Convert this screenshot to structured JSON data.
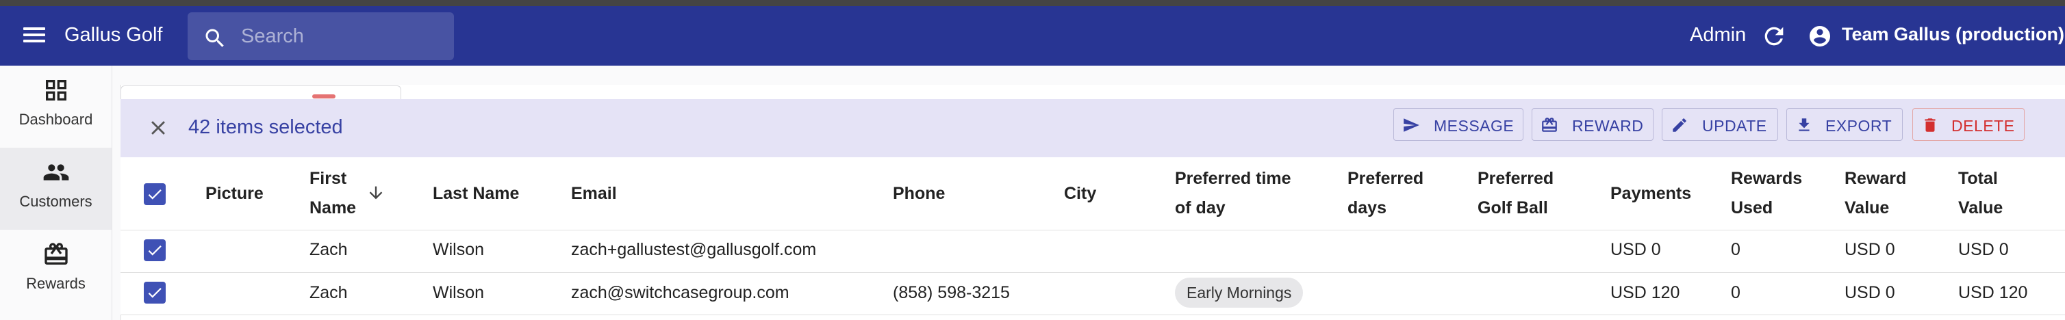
{
  "appbar": {
    "title": "Gallus Golf",
    "search_placeholder": "Search",
    "admin_label": "Admin",
    "team_label": "Team Gallus (production)"
  },
  "sidebar": {
    "items": [
      {
        "label": "Dashboard",
        "icon": "dashboard-icon"
      },
      {
        "label": "Customers",
        "icon": "people-icon",
        "active": true
      },
      {
        "label": "Rewards",
        "icon": "card-giftcard-icon"
      }
    ]
  },
  "bulk_actions": {
    "selected_text": "42 items selected",
    "buttons": [
      {
        "label": "MESSAGE",
        "icon": "send-icon"
      },
      {
        "label": "REWARD",
        "icon": "reward-icon"
      },
      {
        "label": "UPDATE",
        "icon": "edit-icon"
      },
      {
        "label": "EXPORT",
        "icon": "download-icon"
      },
      {
        "label": "DELETE",
        "icon": "trash-icon"
      }
    ]
  },
  "table": {
    "columns": {
      "picture": "Picture",
      "first_name_1": "First",
      "first_name_2": "Name",
      "last_name": "Last Name",
      "email": "Email",
      "phone": "Phone",
      "city": "City",
      "preferred_time_1": "Preferred time",
      "preferred_time_2": "of day",
      "preferred_days_1": "Preferred",
      "preferred_days_2": "days",
      "preferred_ball_1": "Preferred",
      "preferred_ball_2": "Golf Ball",
      "payments": "Payments",
      "rewards_used_1": "Rewards",
      "rewards_used_2": "Used",
      "reward_value_1": "Reward",
      "reward_value_2": "Value",
      "total_value_1": "Total",
      "total_value_2": "Value"
    },
    "sort": {
      "column": "First Name",
      "direction": "descending"
    },
    "rows": [
      {
        "first_name": "Zach",
        "last_name": "Wilson",
        "email": "zach+gallustest@gallusgolf.com",
        "phone": "",
        "city": "",
        "preferred_time": "",
        "payments": "USD 0",
        "rewards_used": "0",
        "reward_value": "USD 0",
        "total_value": "USD 0",
        "checked": true
      },
      {
        "first_name": "Zach",
        "last_name": "Wilson",
        "email": "zach@switchcasegroup.com",
        "phone": "(858) 598-3215",
        "city": "",
        "preferred_time": "Early Mornings",
        "payments": "USD 120",
        "rewards_used": "0",
        "reward_value": "USD 0",
        "total_value": "USD 120",
        "checked": true
      }
    ]
  },
  "colors": {
    "appbar": "#283593",
    "accent": "#3f51b5",
    "bulkbar": "#e5e3f6",
    "danger": "#d32f2f"
  }
}
